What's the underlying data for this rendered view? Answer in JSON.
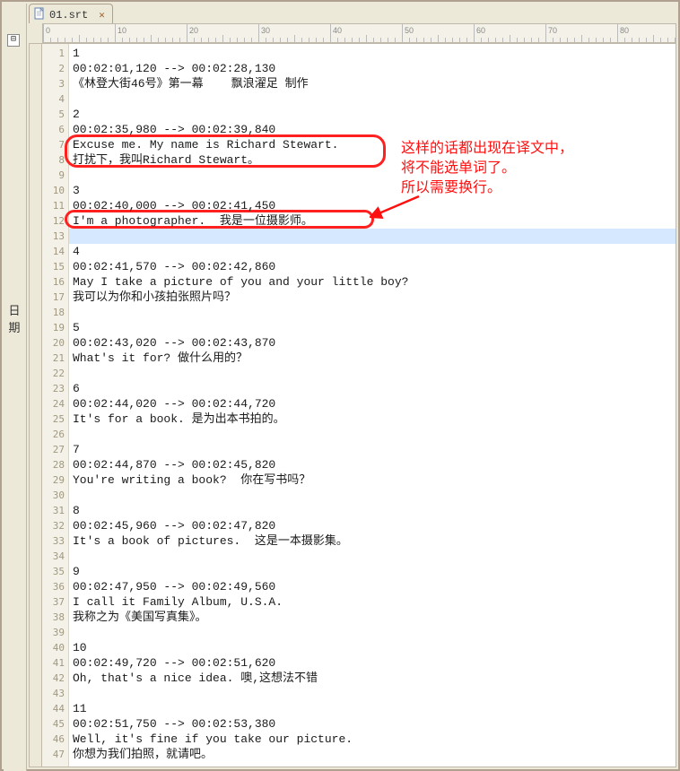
{
  "tab": {
    "filename": "01.srt"
  },
  "sideLabel": "日期",
  "toggleSymbol": "⊟",
  "ruler": {
    "majors": [
      0,
      10,
      20,
      30,
      40,
      50,
      60,
      70,
      80
    ]
  },
  "annotation": {
    "line1": "这样的话都出现在译文中，",
    "line2": "将不能选单词了。",
    "line3": "所以需要换行。"
  },
  "currentLine": 13,
  "lines": [
    "1",
    "00:02:01,120 --> 00:02:28,130",
    "《林登大街46号》第一幕    飘浪濯足 制作",
    "",
    "2",
    "00:02:35,980 --> 00:02:39,840",
    "Excuse me. My name is Richard Stewart.",
    "打扰下，我叫Richard Stewart。",
    "",
    "3",
    "00:02:40,000 --> 00:02:41,450",
    "I'm a photographer.  我是一位摄影师。",
    "",
    "4",
    "00:02:41,570 --> 00:02:42,860",
    "May I take a picture of you and your little boy?",
    "我可以为你和小孩拍张照片吗？",
    "",
    "5",
    "00:02:43,020 --> 00:02:43,870",
    "What's it for? 做什么用的？",
    "",
    "6",
    "00:02:44,020 --> 00:02:44,720",
    "It's for a book. 是为出本书拍的。",
    "",
    "7",
    "00:02:44,870 --> 00:02:45,820",
    "You're writing a book?  你在写书吗？",
    "",
    "8",
    "00:02:45,960 --> 00:02:47,820",
    "It's a book of pictures.  这是一本摄影集。",
    "",
    "9",
    "00:02:47,950 --> 00:02:49,560",
    "I call it Family Album, U.S.A.",
    "我称之为《美国写真集》。",
    "",
    "10",
    "00:02:49,720 --> 00:02:51,620",
    "Oh, that's a nice idea. 噢,这想法不错",
    "",
    "11",
    "00:02:51,750 --> 00:02:53,380",
    "Well, it's fine if you take our picture.",
    "你想为我们拍照，就请吧。"
  ]
}
